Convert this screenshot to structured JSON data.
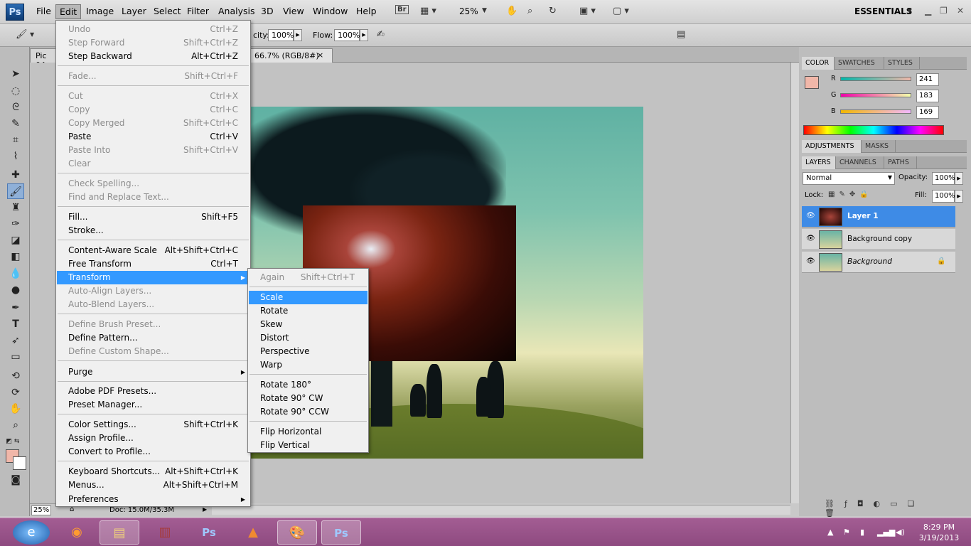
{
  "menubar": {
    "logo": "Ps",
    "items": [
      "File",
      "Edit",
      "Image",
      "Layer",
      "Select",
      "Filter",
      "Analysis",
      "3D",
      "View",
      "Window",
      "Help"
    ],
    "bridge": "Br",
    "zoom": "25%",
    "workspace": "ESSENTIALS"
  },
  "options": {
    "opacity_label": "city:",
    "opacity": "100%",
    "flow_label": "Flow:",
    "flow": "100%"
  },
  "tabs": {
    "tab1": "Pic 04",
    "tab2": "66.7% (RGB/8#)",
    "close": "×"
  },
  "status": {
    "zoom": "25%",
    "doc": "Doc: 15.0M/35.3M"
  },
  "panels": {
    "color_tabs": [
      "COLOR",
      "SWATCHES",
      "STYLES"
    ],
    "r_label": "R",
    "g_label": "G",
    "b_label": "B",
    "r": "241",
    "g": "183",
    "b": "169",
    "fg_color": "#f1b7a9",
    "adj_tabs": [
      "ADJUSTMENTS",
      "MASKS"
    ],
    "layer_tabs": [
      "LAYERS",
      "CHANNELS",
      "PATHS"
    ],
    "blend_mode": "Normal",
    "opacity_label": "Opacity:",
    "opacity": "100%",
    "lock_label": "Lock:",
    "fill_label": "Fill:",
    "fill": "100%",
    "layers": [
      "Layer 1",
      "Background copy",
      "Background"
    ]
  },
  "edit_menu": {
    "undo": {
      "label": "Undo",
      "shortcut": "Ctrl+Z"
    },
    "step_forward": {
      "label": "Step Forward",
      "shortcut": "Shift+Ctrl+Z"
    },
    "step_backward": {
      "label": "Step Backward",
      "shortcut": "Alt+Ctrl+Z"
    },
    "fade": {
      "label": "Fade...",
      "shortcut": "Shift+Ctrl+F"
    },
    "cut": {
      "label": "Cut",
      "shortcut": "Ctrl+X"
    },
    "copy": {
      "label": "Copy",
      "shortcut": "Ctrl+C"
    },
    "copy_merged": {
      "label": "Copy Merged",
      "shortcut": "Shift+Ctrl+C"
    },
    "paste": {
      "label": "Paste",
      "shortcut": "Ctrl+V"
    },
    "paste_into": {
      "label": "Paste Into",
      "shortcut": "Shift+Ctrl+V"
    },
    "clear": {
      "label": "Clear"
    },
    "check_spelling": {
      "label": "Check Spelling..."
    },
    "find_replace": {
      "label": "Find and Replace Text..."
    },
    "fill": {
      "label": "Fill...",
      "shortcut": "Shift+F5"
    },
    "stroke": {
      "label": "Stroke..."
    },
    "content_aware": {
      "label": "Content-Aware Scale",
      "shortcut": "Alt+Shift+Ctrl+C"
    },
    "free_transform": {
      "label": "Free Transform",
      "shortcut": "Ctrl+T"
    },
    "transform": {
      "label": "Transform"
    },
    "auto_align": {
      "label": "Auto-Align Layers..."
    },
    "auto_blend": {
      "label": "Auto-Blend Layers..."
    },
    "define_brush": {
      "label": "Define Brush Preset..."
    },
    "define_pattern": {
      "label": "Define Pattern..."
    },
    "define_shape": {
      "label": "Define Custom Shape..."
    },
    "purge": {
      "label": "Purge"
    },
    "pdf_presets": {
      "label": "Adobe PDF Presets..."
    },
    "preset_manager": {
      "label": "Preset Manager..."
    },
    "color_settings": {
      "label": "Color Settings...",
      "shortcut": "Shift+Ctrl+K"
    },
    "assign_profile": {
      "label": "Assign Profile..."
    },
    "convert_profile": {
      "label": "Convert to Profile..."
    },
    "keyboard_shortcuts": {
      "label": "Keyboard Shortcuts...",
      "shortcut": "Alt+Shift+Ctrl+K"
    },
    "menus": {
      "label": "Menus...",
      "shortcut": "Alt+Shift+Ctrl+M"
    },
    "preferences": {
      "label": "Preferences"
    }
  },
  "transform_menu": {
    "again": {
      "label": "Again",
      "shortcut": "Shift+Ctrl+T"
    },
    "scale": "Scale",
    "rotate": "Rotate",
    "skew": "Skew",
    "distort": "Distort",
    "perspective": "Perspective",
    "warp": "Warp",
    "rotate_180": "Rotate 180°",
    "rotate_90_cw": "Rotate 90° CW",
    "rotate_90_ccw": "Rotate 90° CCW",
    "flip_h": "Flip Horizontal",
    "flip_v": "Flip Vertical"
  },
  "taskbar": {
    "time": "8:29 PM",
    "date": "3/19/2013",
    "ps_label": "Ps"
  }
}
